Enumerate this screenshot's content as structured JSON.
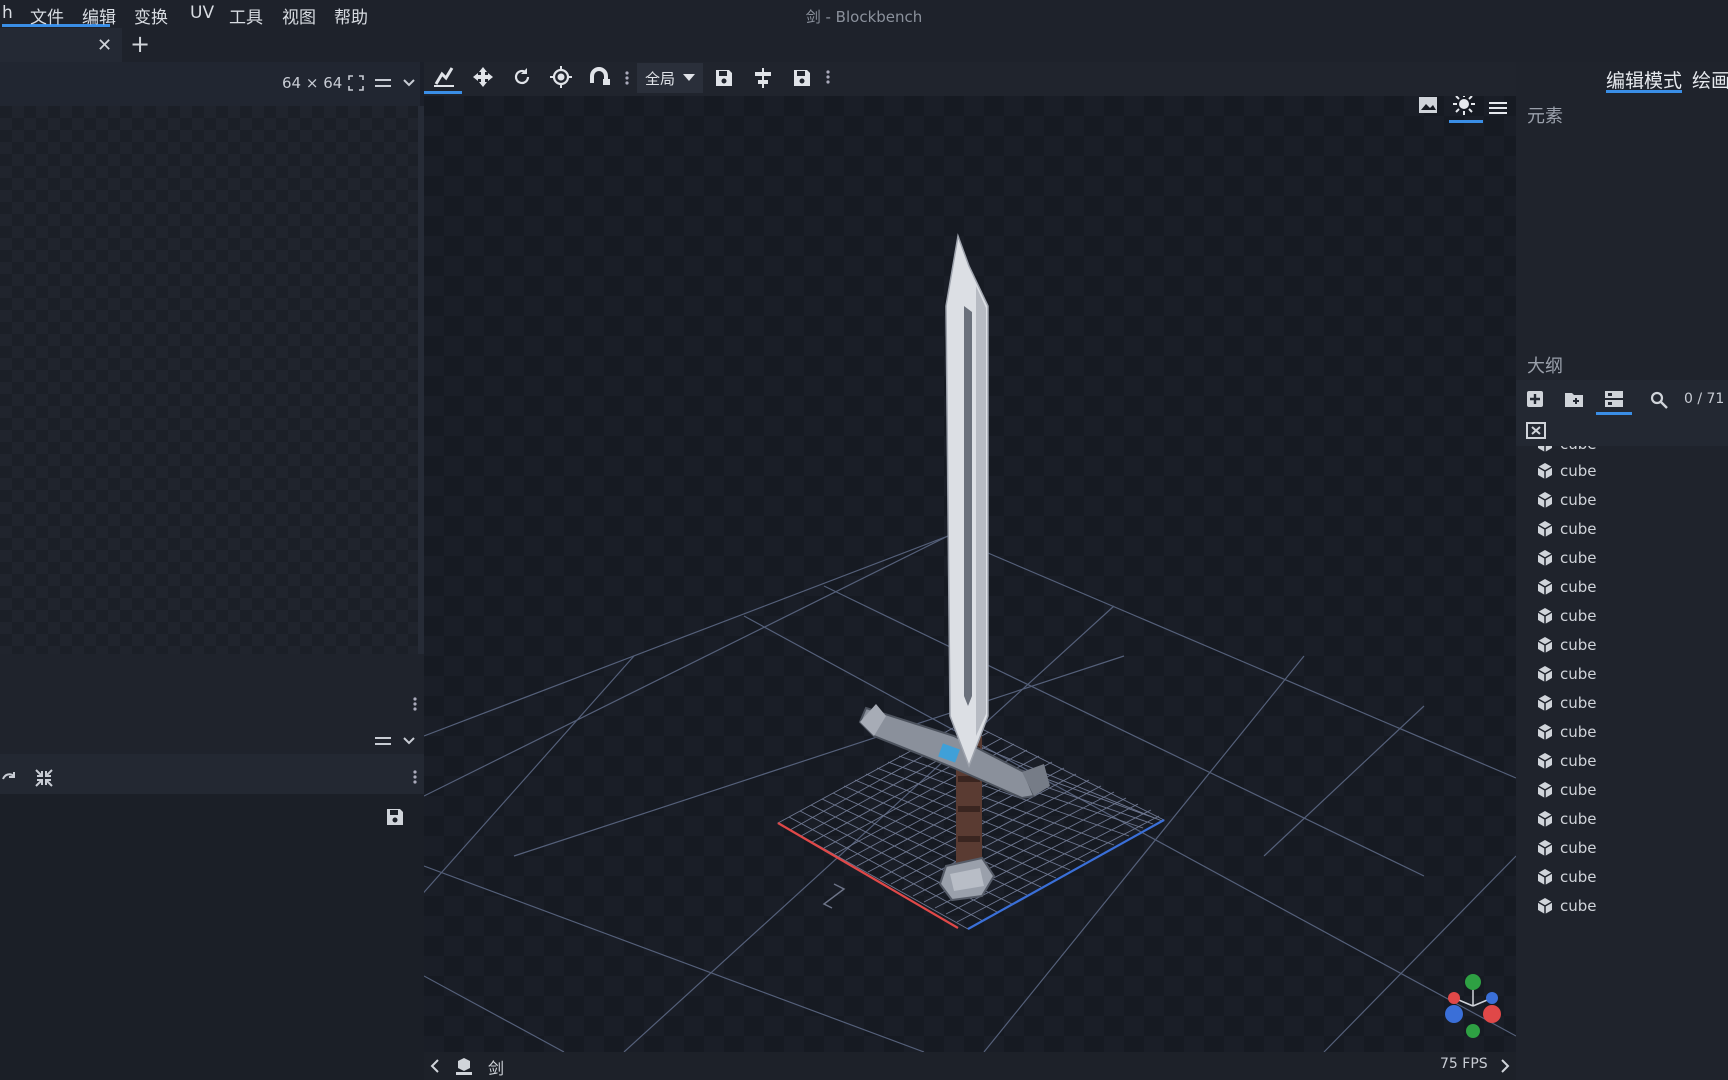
{
  "menu": {
    "app_letter": "h",
    "items": [
      "文件",
      "编辑",
      "变换",
      "UV",
      "工具",
      "视图",
      "帮助"
    ],
    "window_title": "剑 - Blockbench"
  },
  "tabs": {
    "close_symbol": "✕",
    "add_symbol": "+"
  },
  "uv_panel": {
    "texture_size": "64 × 64"
  },
  "toolbar": {
    "space_dropdown": "全局",
    "tools": [
      "move-tool-icon",
      "translate-icon",
      "rotate-icon",
      "pivot-icon",
      "vertex-snap-icon"
    ]
  },
  "modes": {
    "edit_mode": "编辑模式",
    "paint_mode": "绘画"
  },
  "right_panel": {
    "elements_title": "元素",
    "outliner_title": "大纲",
    "element_count": "0 / 71",
    "partial_item": "cube",
    "items": [
      "cube",
      "cube",
      "cube",
      "cube",
      "cube",
      "cube",
      "cube",
      "cube",
      "cube",
      "cube",
      "cube",
      "cube",
      "cube",
      "cube",
      "cube",
      "cube"
    ]
  },
  "status": {
    "model_name": "剑",
    "fps": "75 FPS"
  },
  "colors": {
    "accent": "#3a8ee6",
    "background": "#1b1f29",
    "axis_x": "#e04848",
    "axis_y": "#3fb950",
    "axis_z": "#3a6fd8"
  }
}
